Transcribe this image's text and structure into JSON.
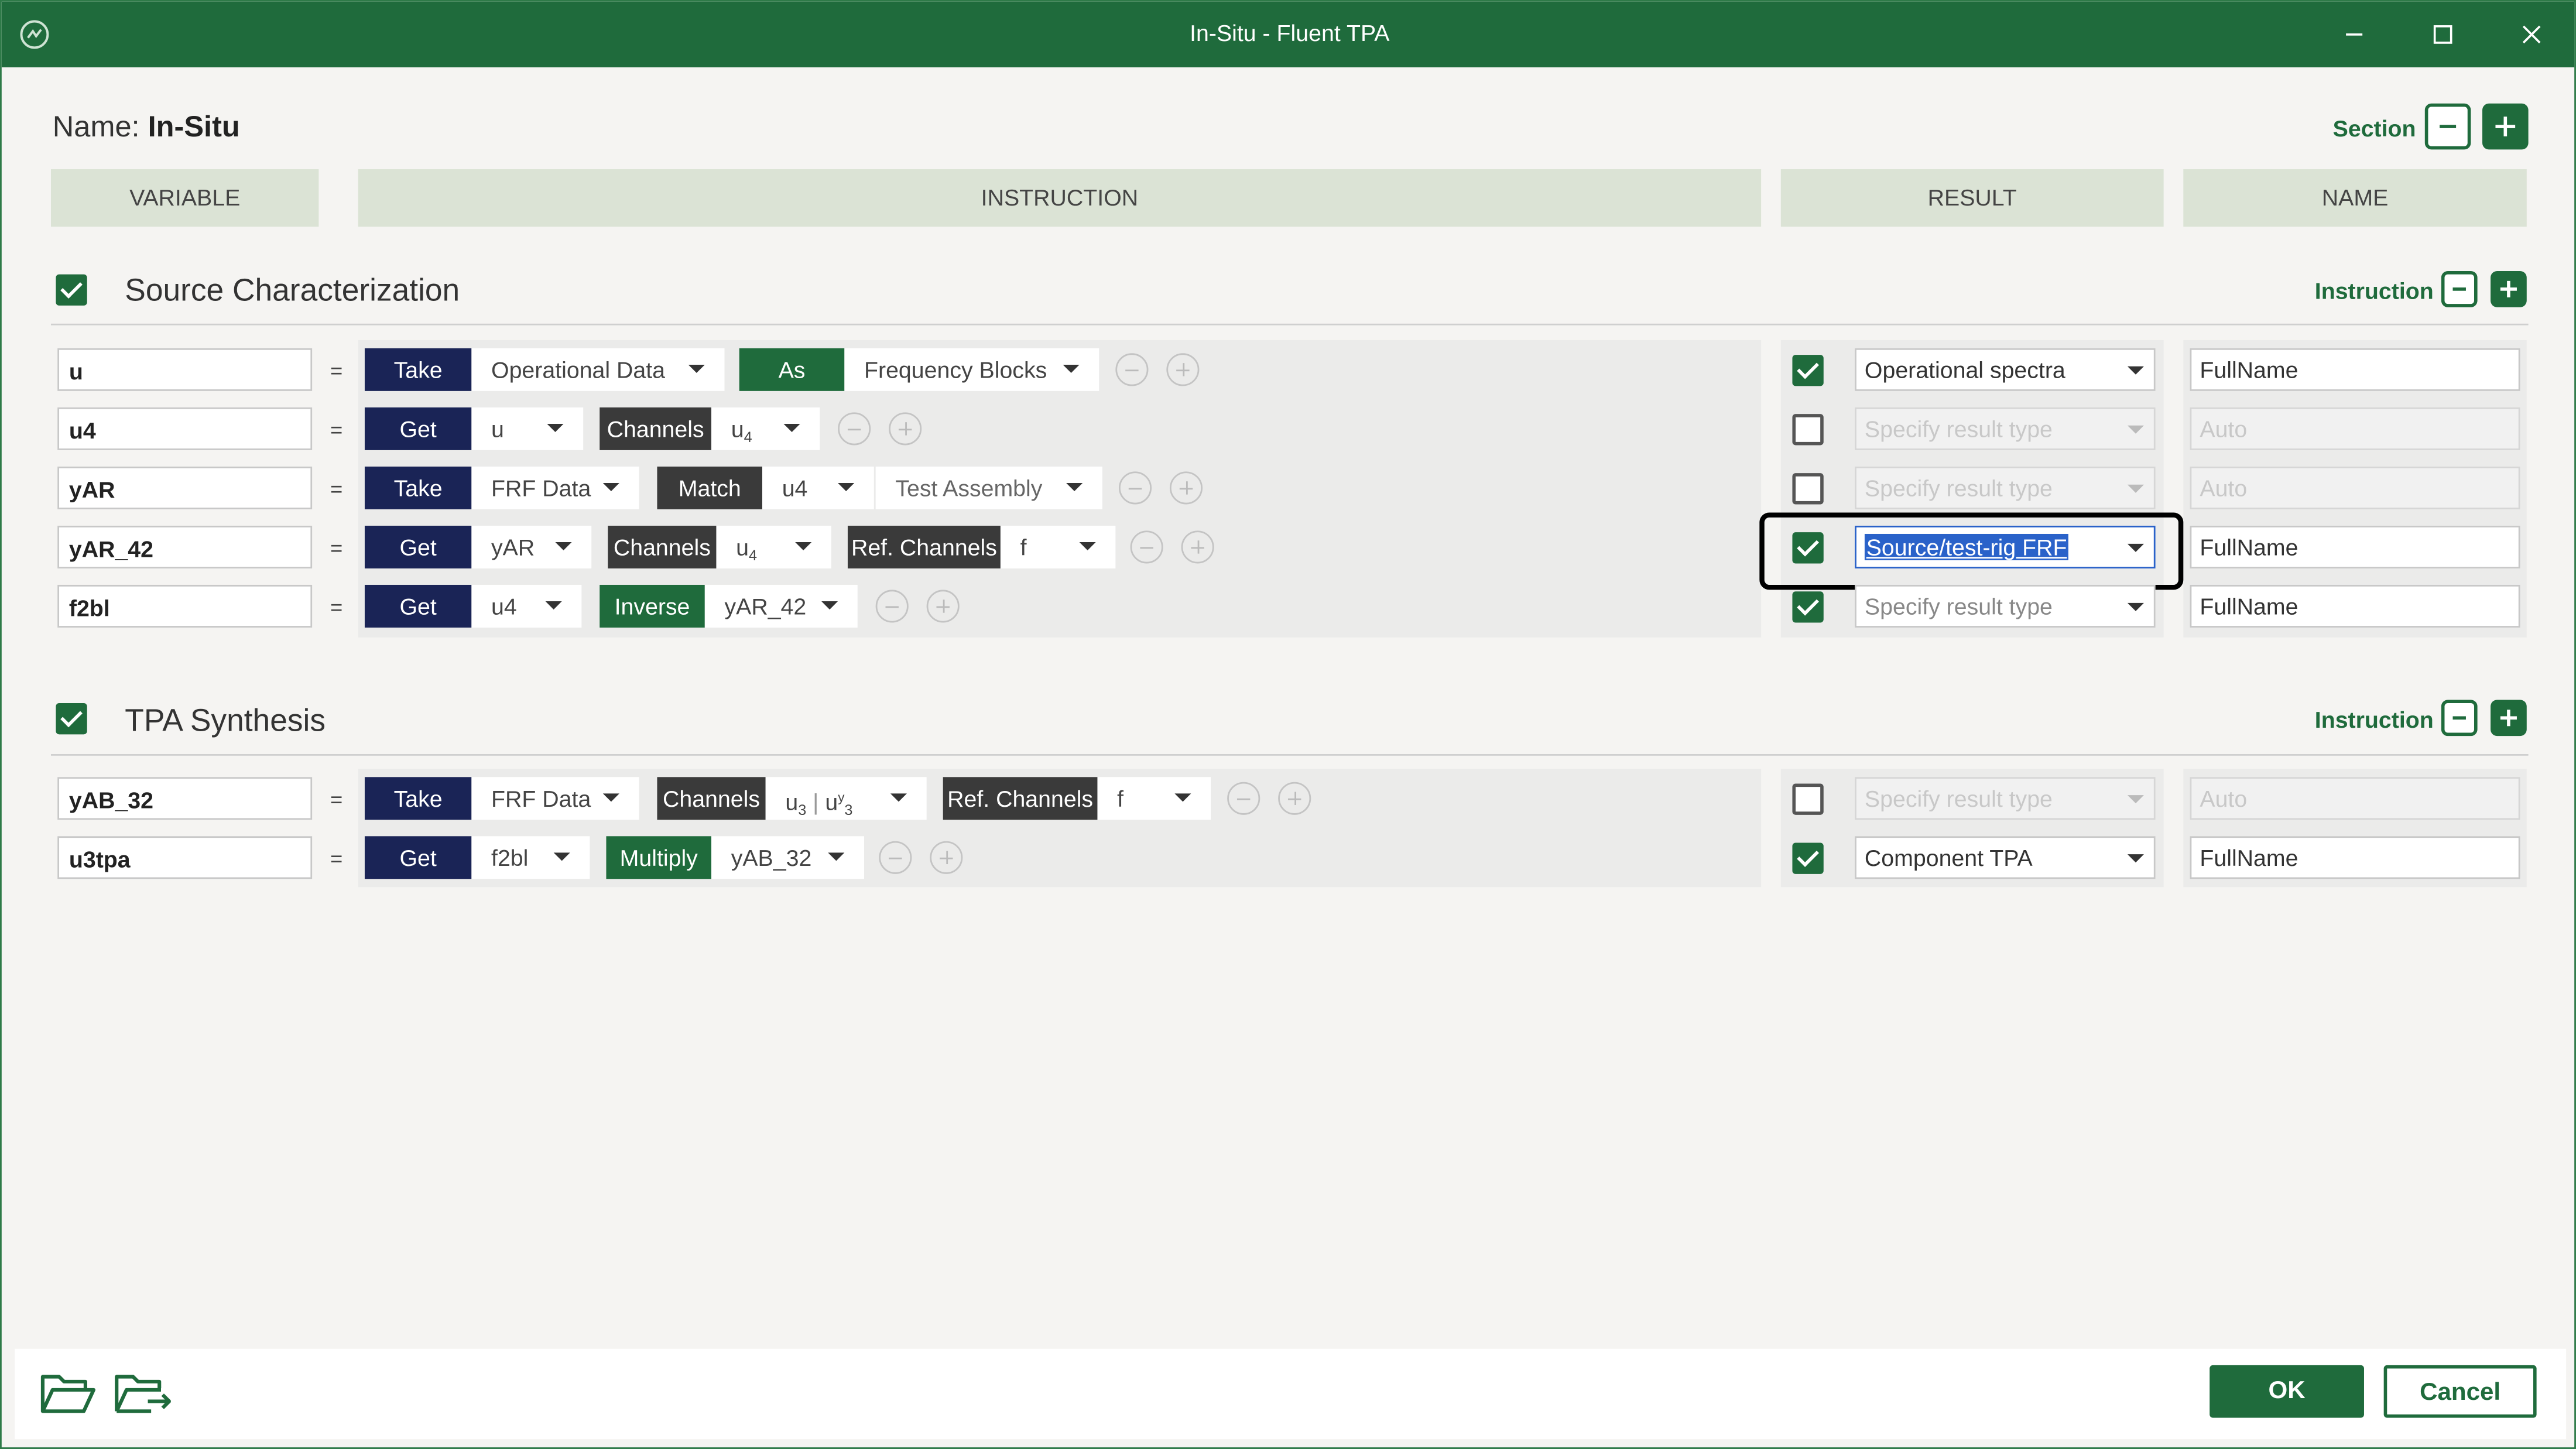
{
  "window": {
    "title": "In-Situ - Fluent TPA"
  },
  "name": {
    "label": "Name:",
    "value": "In-Situ"
  },
  "section_controls": {
    "label": "Section"
  },
  "columns": {
    "variable": "VARIABLE",
    "instruction": "INSTRUCTION",
    "result": "RESULT",
    "name": "NAME"
  },
  "sections": [
    {
      "title": "Source Characterization",
      "control_label": "Instruction",
      "checked": true,
      "rows": [
        {
          "variable": "u",
          "equals": "=",
          "tokens": [
            "Take",
            "Operational Data",
            "As",
            "Frequency Blocks"
          ],
          "result_checked": true,
          "result": "Operational spectra",
          "name": "FullName"
        },
        {
          "variable": "u4",
          "equals": "=",
          "tokens": [
            "Get",
            "u",
            "Channels",
            "u",
            "4"
          ],
          "result_checked": false,
          "result": "Specify result type",
          "name": "Auto"
        },
        {
          "variable": "yAR",
          "equals": "=",
          "tokens": [
            "Take",
            "FRF Data",
            "Match",
            "u4",
            "Test Assembly"
          ],
          "result_checked": false,
          "result": "Specify result type",
          "name": "Auto"
        },
        {
          "variable": "yAR_42",
          "equals": "=",
          "tokens": [
            "Get",
            "yAR",
            "Channels",
            "u",
            "4",
            "Ref. Channels",
            "f"
          ],
          "result_checked": true,
          "result": "Source/test-rig FRF",
          "name": "FullName"
        },
        {
          "variable": "f2bl",
          "equals": "=",
          "tokens": [
            "Get",
            "u4",
            "Inverse",
            "yAR_42"
          ],
          "result_checked": true,
          "result": "Specify result type",
          "name": "FullName"
        }
      ]
    },
    {
      "title": "TPA Synthesis",
      "control_label": "Instruction",
      "checked": true,
      "rows": [
        {
          "variable": "yAB_32",
          "equals": "=",
          "tokens": [
            "Take",
            "FRF Data",
            "Channels",
            "u",
            "3",
            "|",
            "u",
            "y",
            "3",
            "Ref. Channels",
            "f"
          ],
          "result_checked": false,
          "result": "Specify result type",
          "name": "Auto"
        },
        {
          "variable": "u3tpa",
          "equals": "=",
          "tokens": [
            "Get",
            "f2bl",
            "Multiply",
            "yAB_32"
          ],
          "result_checked": true,
          "result": "Component TPA",
          "name": "FullName"
        }
      ]
    }
  ],
  "footer": {
    "ok": "OK",
    "cancel": "Cancel",
    "icons": [
      "open-folder-icon",
      "export-folder-icon"
    ]
  },
  "colors": {
    "brand_green": "#1f6b3c",
    "operator_navy": "#1a2456",
    "operator_dark": "#3a3a3a",
    "selection_blue": "#2a62c9"
  }
}
